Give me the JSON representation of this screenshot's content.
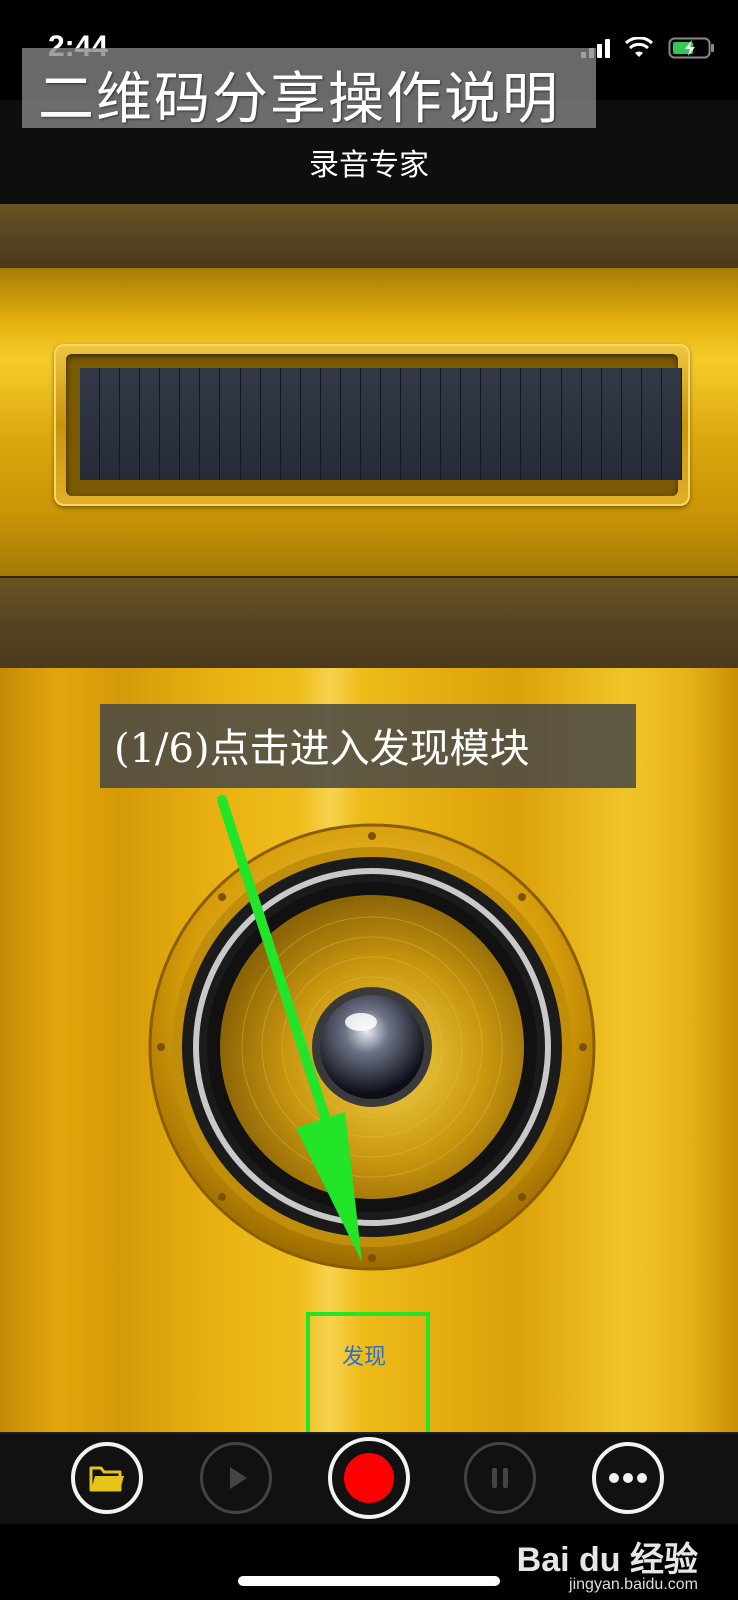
{
  "status_bar": {
    "time": "2:44"
  },
  "banner": {
    "title": "二维码分享操作说明"
  },
  "nav": {
    "title": "录音专家"
  },
  "instruction": {
    "text": "(1/6)点击进入发现模块"
  },
  "discover": {
    "label": "发现"
  },
  "toolbar": {
    "buttons": [
      {
        "name": "folder",
        "icon": "folder-icon"
      },
      {
        "name": "play",
        "icon": "play-icon"
      },
      {
        "name": "record",
        "icon": "record-icon"
      },
      {
        "name": "pause",
        "icon": "pause-icon"
      },
      {
        "name": "more",
        "icon": "more-icon"
      }
    ]
  },
  "watermark": {
    "brand": "Bai du 经验",
    "url": "jingyan.baidu.com"
  },
  "colors": {
    "highlight": "#22e52a",
    "record": "#ff0000",
    "link": "#2a6fd6",
    "gold": "#e8b214"
  }
}
